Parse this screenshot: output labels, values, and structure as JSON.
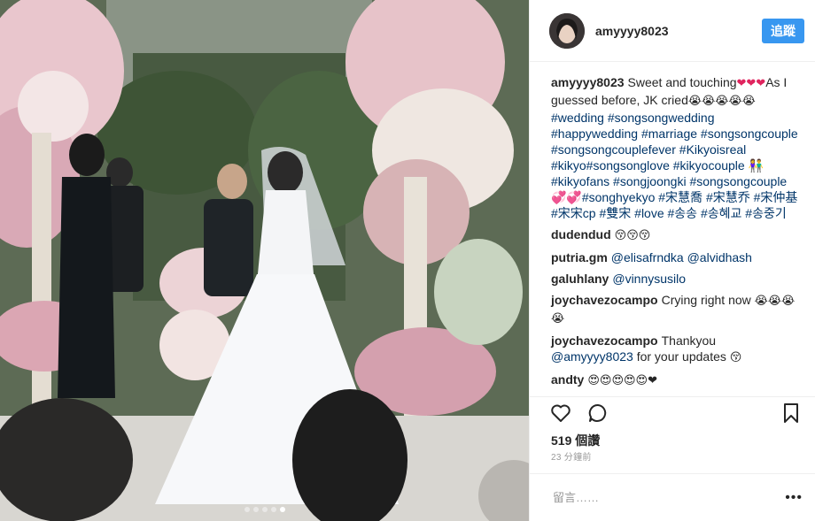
{
  "post": {
    "author": "amyyyy8023",
    "follow_label": "追蹤",
    "caption": {
      "user": "amyyyy8023",
      "text1": "Sweet and touching",
      "emoji1": "❤❤❤",
      "text2": "As I guessed before, JK cried",
      "emoji2": "😭😭😭😭😭",
      "tags": [
        "#wedding",
        "#songsongwedding",
        "#happywedding",
        "#marriage",
        "#songsongcouple",
        "#songsongcouplefever",
        "#Kikyoisreal",
        "#kikyo#songsonglove",
        "#kikyocouple",
        "👫#kikyofans",
        "#songjoongki",
        "#songsongcouple💞💞#songhyekyo",
        "#宋慧喬",
        "#宋慧乔",
        "#宋仲基",
        "#宋宋cp",
        "#雙宋",
        "#love",
        "#송송",
        "#송혜교",
        "#송중기"
      ]
    },
    "comments": [
      {
        "user": "dudendud",
        "text": "",
        "emoji": "😚😚😚"
      },
      {
        "user": "putria.gm",
        "text": "",
        "mentions": [
          "@elisafrndka",
          "@alvidhash"
        ]
      },
      {
        "user": "galuhlany",
        "text": "",
        "mentions": [
          "@vinnysusilo"
        ]
      },
      {
        "user": "joychavezocampo",
        "text": "Crying right now",
        "emoji": "😭😭😭😭"
      },
      {
        "user": "joychavezocampo",
        "text": "Thankyou",
        "mentions": [
          "@amyyyy8023"
        ],
        "text2": "for your updates",
        "emoji": "😚"
      },
      {
        "user": "andty",
        "text": "",
        "emoji": "😍😍😍😍😍❤"
      }
    ],
    "likes": "519 個讚",
    "time": "23 分鐘前",
    "comment_placeholder": "留言……",
    "more_label": "•••",
    "carousel": {
      "count": 5,
      "active_index": 4
    }
  },
  "icons": {
    "like": "heart-icon",
    "comment": "comment-bubble-icon",
    "save": "bookmark-icon",
    "more": "more-dots-icon"
  },
  "colors": {
    "follow_button": "#3897f0",
    "link": "#003569",
    "text": "#262626",
    "muted": "#999999"
  }
}
